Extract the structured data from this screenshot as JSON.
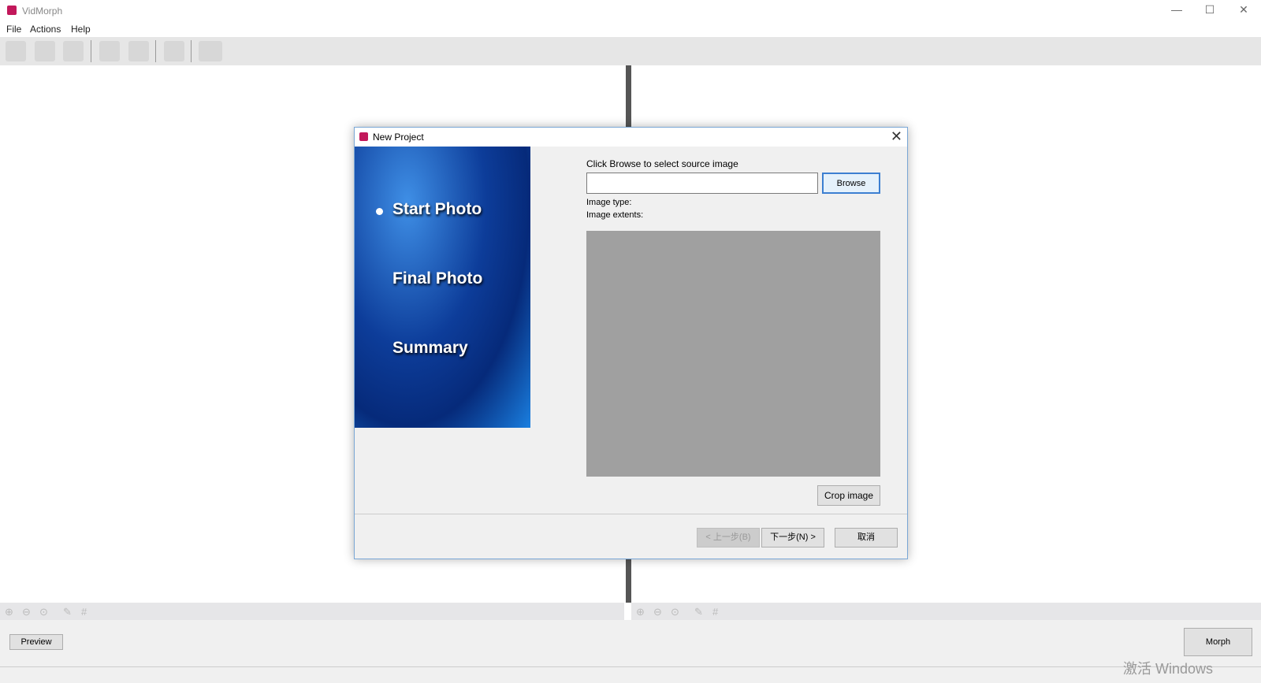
{
  "app": {
    "title": "VidMorph"
  },
  "menu": [
    "File",
    "Actions",
    "Help"
  ],
  "toolbar_icons": [
    "new-icon",
    "open-icon",
    "save-icon",
    "import-icon",
    "refresh-icon",
    "keys-icon",
    "film-icon"
  ],
  "zoom_icons": [
    "zoom-in-icon",
    "zoom-out-icon",
    "zoom-fit-icon",
    "edit-icon",
    "grid-icon"
  ],
  "bottom": {
    "preview": "Preview",
    "morph": "Morph"
  },
  "watermark": "激活 Windows",
  "dialog": {
    "title": "New Project",
    "steps": [
      "Start Photo",
      "Final Photo",
      "Summary"
    ],
    "active_step": 0,
    "instruction": "Click Browse to select source image",
    "path_value": "",
    "browse": "Browse",
    "image_type": "Image type:",
    "image_extents": "Image extents:",
    "crop": "Crop image",
    "back": "< 上一步(B)",
    "next": "下一步(N) >",
    "cancel": "取消"
  }
}
